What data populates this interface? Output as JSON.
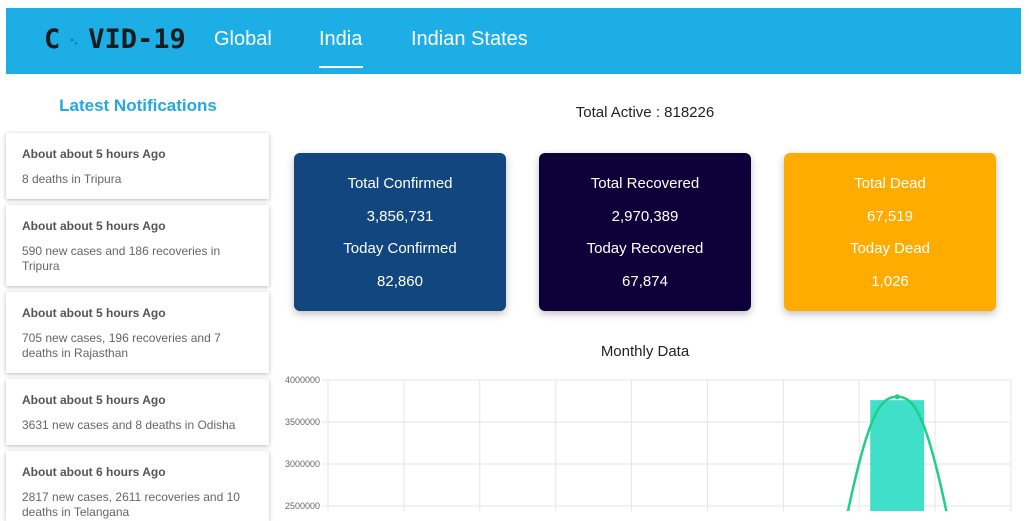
{
  "header": {
    "logo_left": "C",
    "logo_right": "VID-19",
    "logo_icon": "virus-icon",
    "nav": [
      {
        "label": "Global"
      },
      {
        "label": "India"
      },
      {
        "label": "Indian States"
      }
    ],
    "active_nav": "India",
    "colors": {
      "bar": "#1eaee6",
      "logo_icon": "#1eaee6"
    }
  },
  "notifications": {
    "title": "Latest Notifications",
    "items": [
      {
        "time": "About about 5 hours Ago",
        "text": "8 deaths in Tripura"
      },
      {
        "time": "About about 5 hours Ago",
        "text": "590 new cases and 186 recoveries in Tripura"
      },
      {
        "time": "About about 5 hours Ago",
        "text": "705 new cases, 196 recoveries and 7 deaths in Rajasthan"
      },
      {
        "time": "About about 5 hours Ago",
        "text": "3631 new cases and 8 deaths in Odisha"
      },
      {
        "time": "About about 6 hours Ago",
        "text": "2817 new cases, 2611 recoveries and 10 deaths in Telangana"
      }
    ]
  },
  "summary": {
    "total_active": "Total Active : 818226",
    "cards": [
      {
        "label1": "Total Confirmed",
        "value1": "3,856,731",
        "label2": "Today Confirmed",
        "value2": "82,860",
        "color": "#11477e",
        "text_color": "#ffffff"
      },
      {
        "label1": "Total Recovered",
        "value1": "2,970,389",
        "label2": "Today Recovered",
        "value2": "67,874",
        "color": "#0e0038",
        "text_color": "#ffffff"
      },
      {
        "label1": "Total Dead",
        "value1": "67,519",
        "label2": "Today Dead",
        "value2": "1,026",
        "color": "#ffab00",
        "text_color": "#ffffff"
      }
    ]
  },
  "chart_data": {
    "type": "bar",
    "title": "Monthly Data",
    "y_ticks": [
      "4000000",
      "3500000",
      "3000000",
      "2500000"
    ],
    "ylim": [
      2500000,
      4000000
    ],
    "grid": true,
    "bar_color": "#40dfca",
    "line_color": "#1fcf84",
    "series": [
      {
        "type": "bar",
        "values": [
          3760000
        ]
      },
      {
        "type": "line",
        "values": [
          3800000
        ]
      }
    ]
  }
}
